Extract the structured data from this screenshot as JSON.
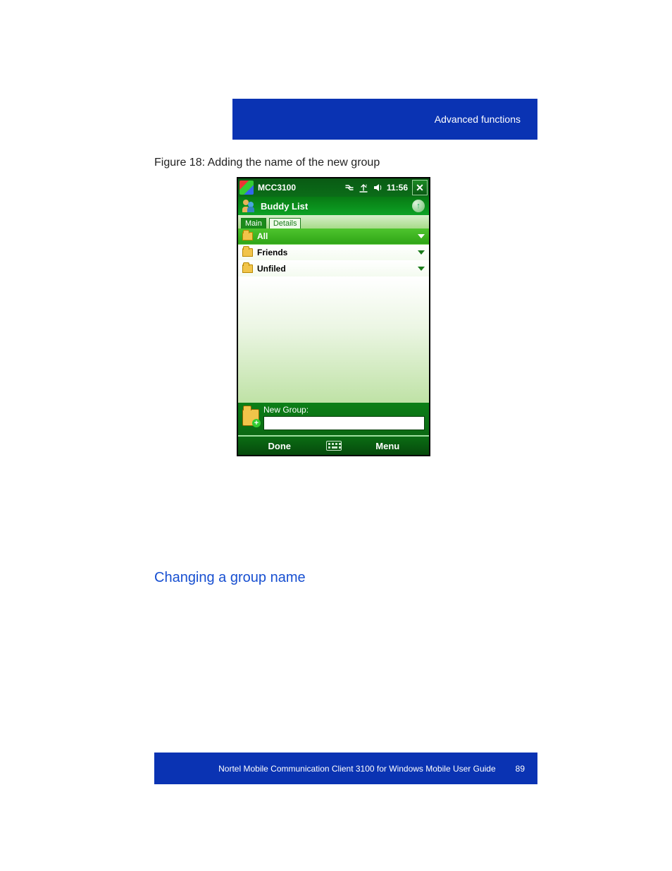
{
  "header": {
    "section": "Advanced functions"
  },
  "figure": {
    "caption": "Figure 18: Adding the name of the new group"
  },
  "section_heading": "Changing a group name",
  "footer": {
    "text": "Nortel Mobile Communication Client 3100 for Windows Mobile User Guide",
    "page": "89"
  },
  "device": {
    "titlebar": {
      "app_name": "MCC3100",
      "time": "11:56",
      "close_glyph": "✕"
    },
    "subheader": {
      "title": "Buddy List",
      "up_glyph": "↑"
    },
    "tabs": {
      "main": "Main",
      "details": "Details"
    },
    "groups": {
      "all": "All",
      "friends": "Friends",
      "unfiled": "Unfiled"
    },
    "new_group": {
      "label": "New Group:",
      "value": ""
    },
    "softkeys": {
      "left": "Done",
      "right": "Menu"
    }
  }
}
